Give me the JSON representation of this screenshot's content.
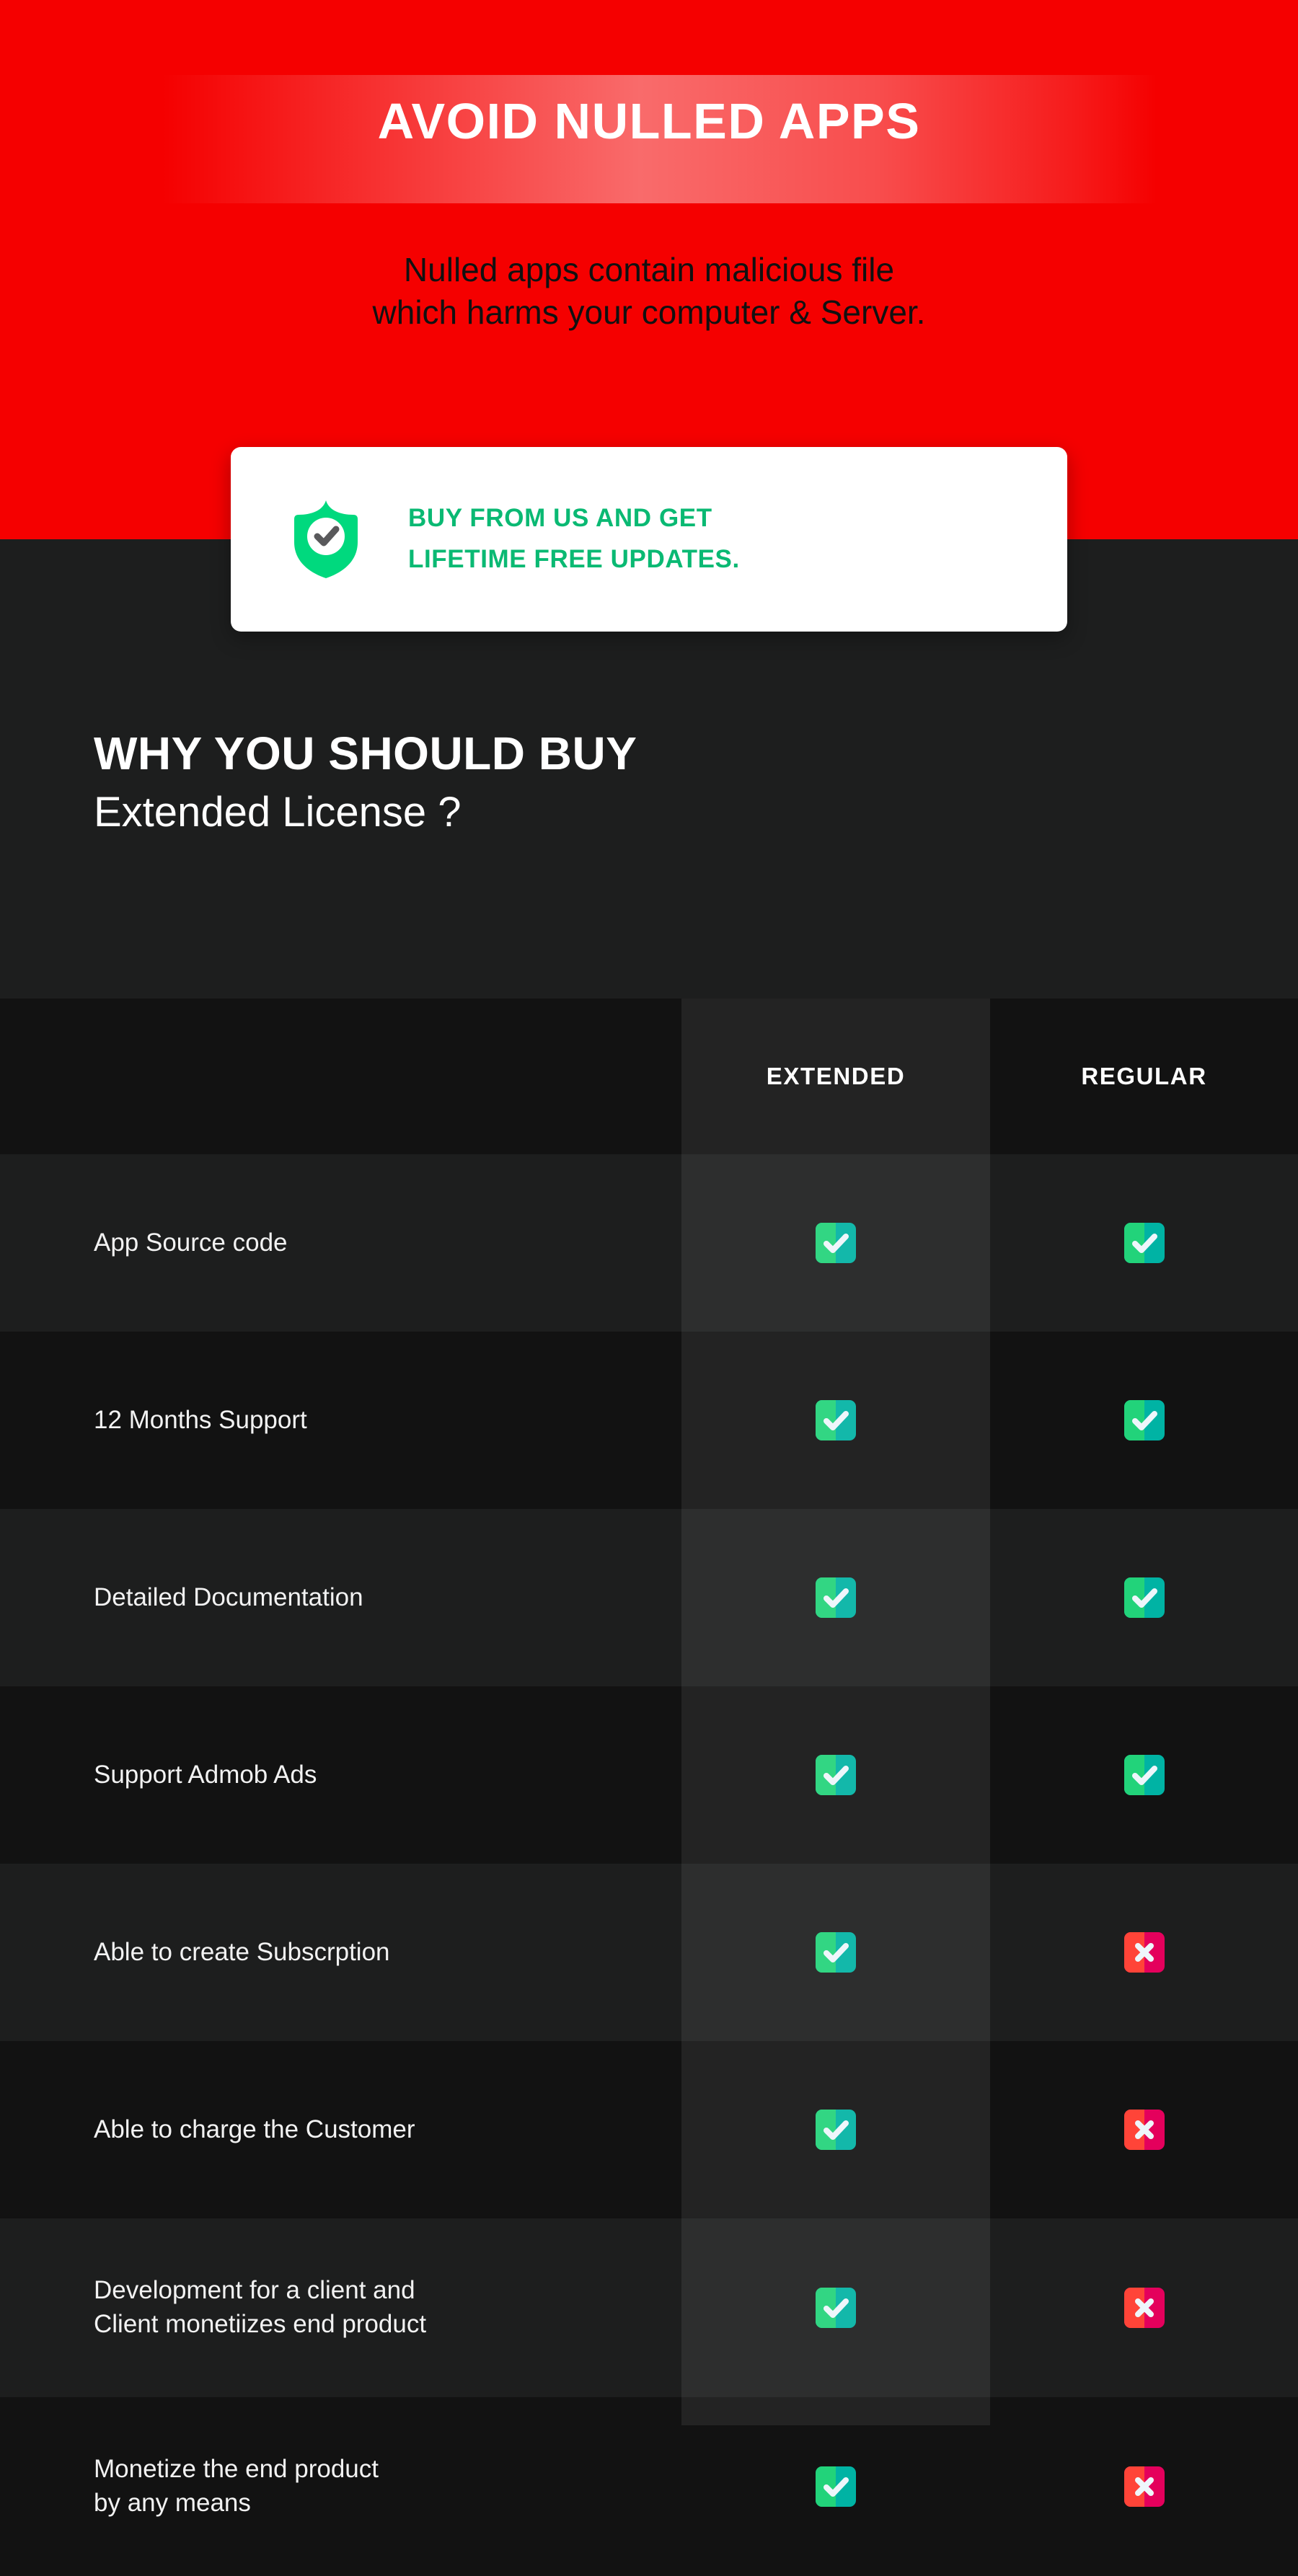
{
  "hero": {
    "title": "AVOID NULLED APPS",
    "subtitle_line1": "Nulled apps contain malicious file",
    "subtitle_line2": "which harms your computer & Server.",
    "background_color": "#F50000",
    "title_color": "#FFFFFF",
    "subtitle_color": "#111111"
  },
  "promo_card": {
    "icon": "shield-check-icon",
    "line1": "BUY FROM US AND GET",
    "line2": "LIFETIME FREE UPDATES.",
    "text_color": "#0AB973",
    "card_color": "#FFFFFF",
    "shield_color": "#00D97E"
  },
  "section": {
    "heading_line1": "WHY YOU SHOULD BUY",
    "heading_line2": "Extended License ?",
    "background_color": "#1D1E1E",
    "text_color": "#FFFFFF"
  },
  "comparison": {
    "columns": [
      {
        "key": "feature",
        "label": ""
      },
      {
        "key": "extended",
        "label": "EXTENDED",
        "highlighted": true
      },
      {
        "key": "regular",
        "label": "REGULAR",
        "highlighted": false
      }
    ],
    "icon_available": "check-icon",
    "icon_unavailable": "cross-icon",
    "check_colors": [
      "#22D37A",
      "#00B3A4"
    ],
    "cross_colors": [
      "#FF4438",
      "#E4005C"
    ],
    "row_color_odd": "#1D1E1E",
    "row_color_even": "#121212",
    "rows": [
      {
        "feature_lines": [
          "App Source code"
        ],
        "extended": true,
        "regular": true
      },
      {
        "feature_lines": [
          "12 Months Support"
        ],
        "extended": true,
        "regular": true
      },
      {
        "feature_lines": [
          "Detailed Documentation"
        ],
        "extended": true,
        "regular": true
      },
      {
        "feature_lines": [
          "Support Admob Ads"
        ],
        "extended": true,
        "regular": true
      },
      {
        "feature_lines": [
          "Able to create Subscrption"
        ],
        "extended": true,
        "regular": false
      },
      {
        "feature_lines": [
          "Able to charge the Customer"
        ],
        "extended": true,
        "regular": false
      },
      {
        "feature_lines": [
          "Development for a client and",
          "Client monetiizes end product"
        ],
        "extended": true,
        "regular": false
      },
      {
        "feature_lines": [
          "Monetize the end product",
          "by any means"
        ],
        "extended": true,
        "regular": false
      }
    ]
  }
}
